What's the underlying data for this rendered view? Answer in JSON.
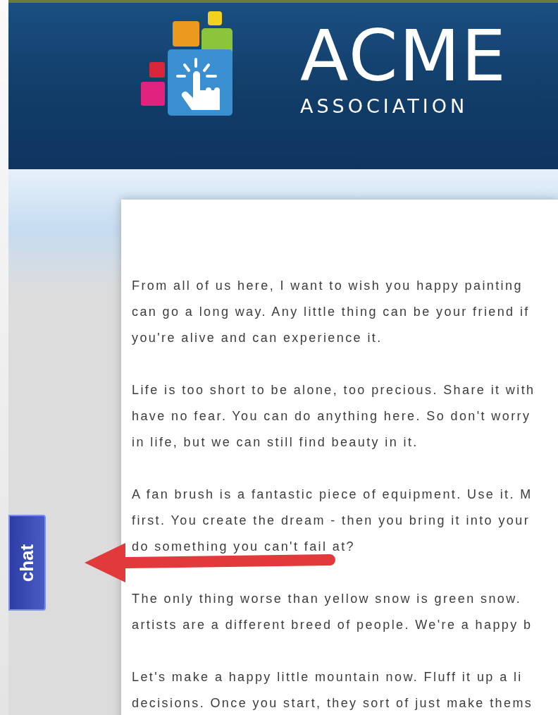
{
  "header": {
    "logo_title": "ACME",
    "logo_subtitle": "ASSOCIATION"
  },
  "chat_tab": {
    "label": "chat"
  },
  "content": {
    "paragraphs": [
      {
        "lines": [
          "From all of us here, I want to wish you happy painting",
          "can go a long way. Any little thing can be your friend if",
          "you're alive and can experience it."
        ]
      },
      {
        "lines": [
          "Life is too short to be alone, too precious. Share it with",
          "have no fear. You can do anything here. So don't worry",
          "in life, but we can still find beauty in it."
        ]
      },
      {
        "lines": [
          "A fan brush is a fantastic piece of equipment. Use it. M",
          "first. You create the dream - then you bring it into your",
          "do something you can't fail at?"
        ]
      },
      {
        "lines": [
          "The only thing worse than yellow snow is green snow.",
          "artists are a different breed of people. We're a happy b"
        ]
      },
      {
        "lines": [
          "Let's make a happy little mountain now. Fluff it up a li",
          "decisions. Once you start, they sort of just make thems"
        ]
      }
    ]
  }
}
